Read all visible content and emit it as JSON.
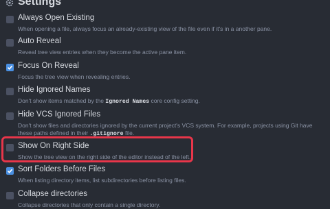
{
  "header": {
    "title": "Settings"
  },
  "settings": [
    {
      "title": "Always Open Existing",
      "desc": "When opening a file, always focus an already-existing view of the file even if it's in a another pane.",
      "checked": false
    },
    {
      "title": "Auto Reveal",
      "desc": "Reveal tree view entries when they become the active pane item.",
      "checked": false
    },
    {
      "title": "Focus On Reveal",
      "desc": "Focus the tree view when revealing entries.",
      "checked": true
    },
    {
      "title": "Hide Ignored Names",
      "desc_pre": "Don't show items matched by the ",
      "desc_code": "Ignored Names",
      "desc_post": " core config setting.",
      "checked": false
    },
    {
      "title": "Hide VCS Ignored Files",
      "desc_pre": "Don't show files and directories ignored by the current project's VCS system. For example, projects using Git have these paths defined in their ",
      "desc_code": ".gitignore",
      "desc_post": " file.",
      "checked": false
    },
    {
      "title": "Show On Right Side",
      "desc": "Show the tree view on the right side of the editor instead of the left.",
      "checked": false
    },
    {
      "title": "Sort Folders Before Files",
      "desc": "When listing directory items, list subdirectories before listing files.",
      "checked": true
    },
    {
      "title": "Collapse directories",
      "desc": "Collapse directories that only contain a single directory.",
      "checked": false
    }
  ],
  "colors": {
    "background": "#282c34",
    "checkbox_checked": "#4a90e2",
    "highlight": "#e8364a"
  }
}
